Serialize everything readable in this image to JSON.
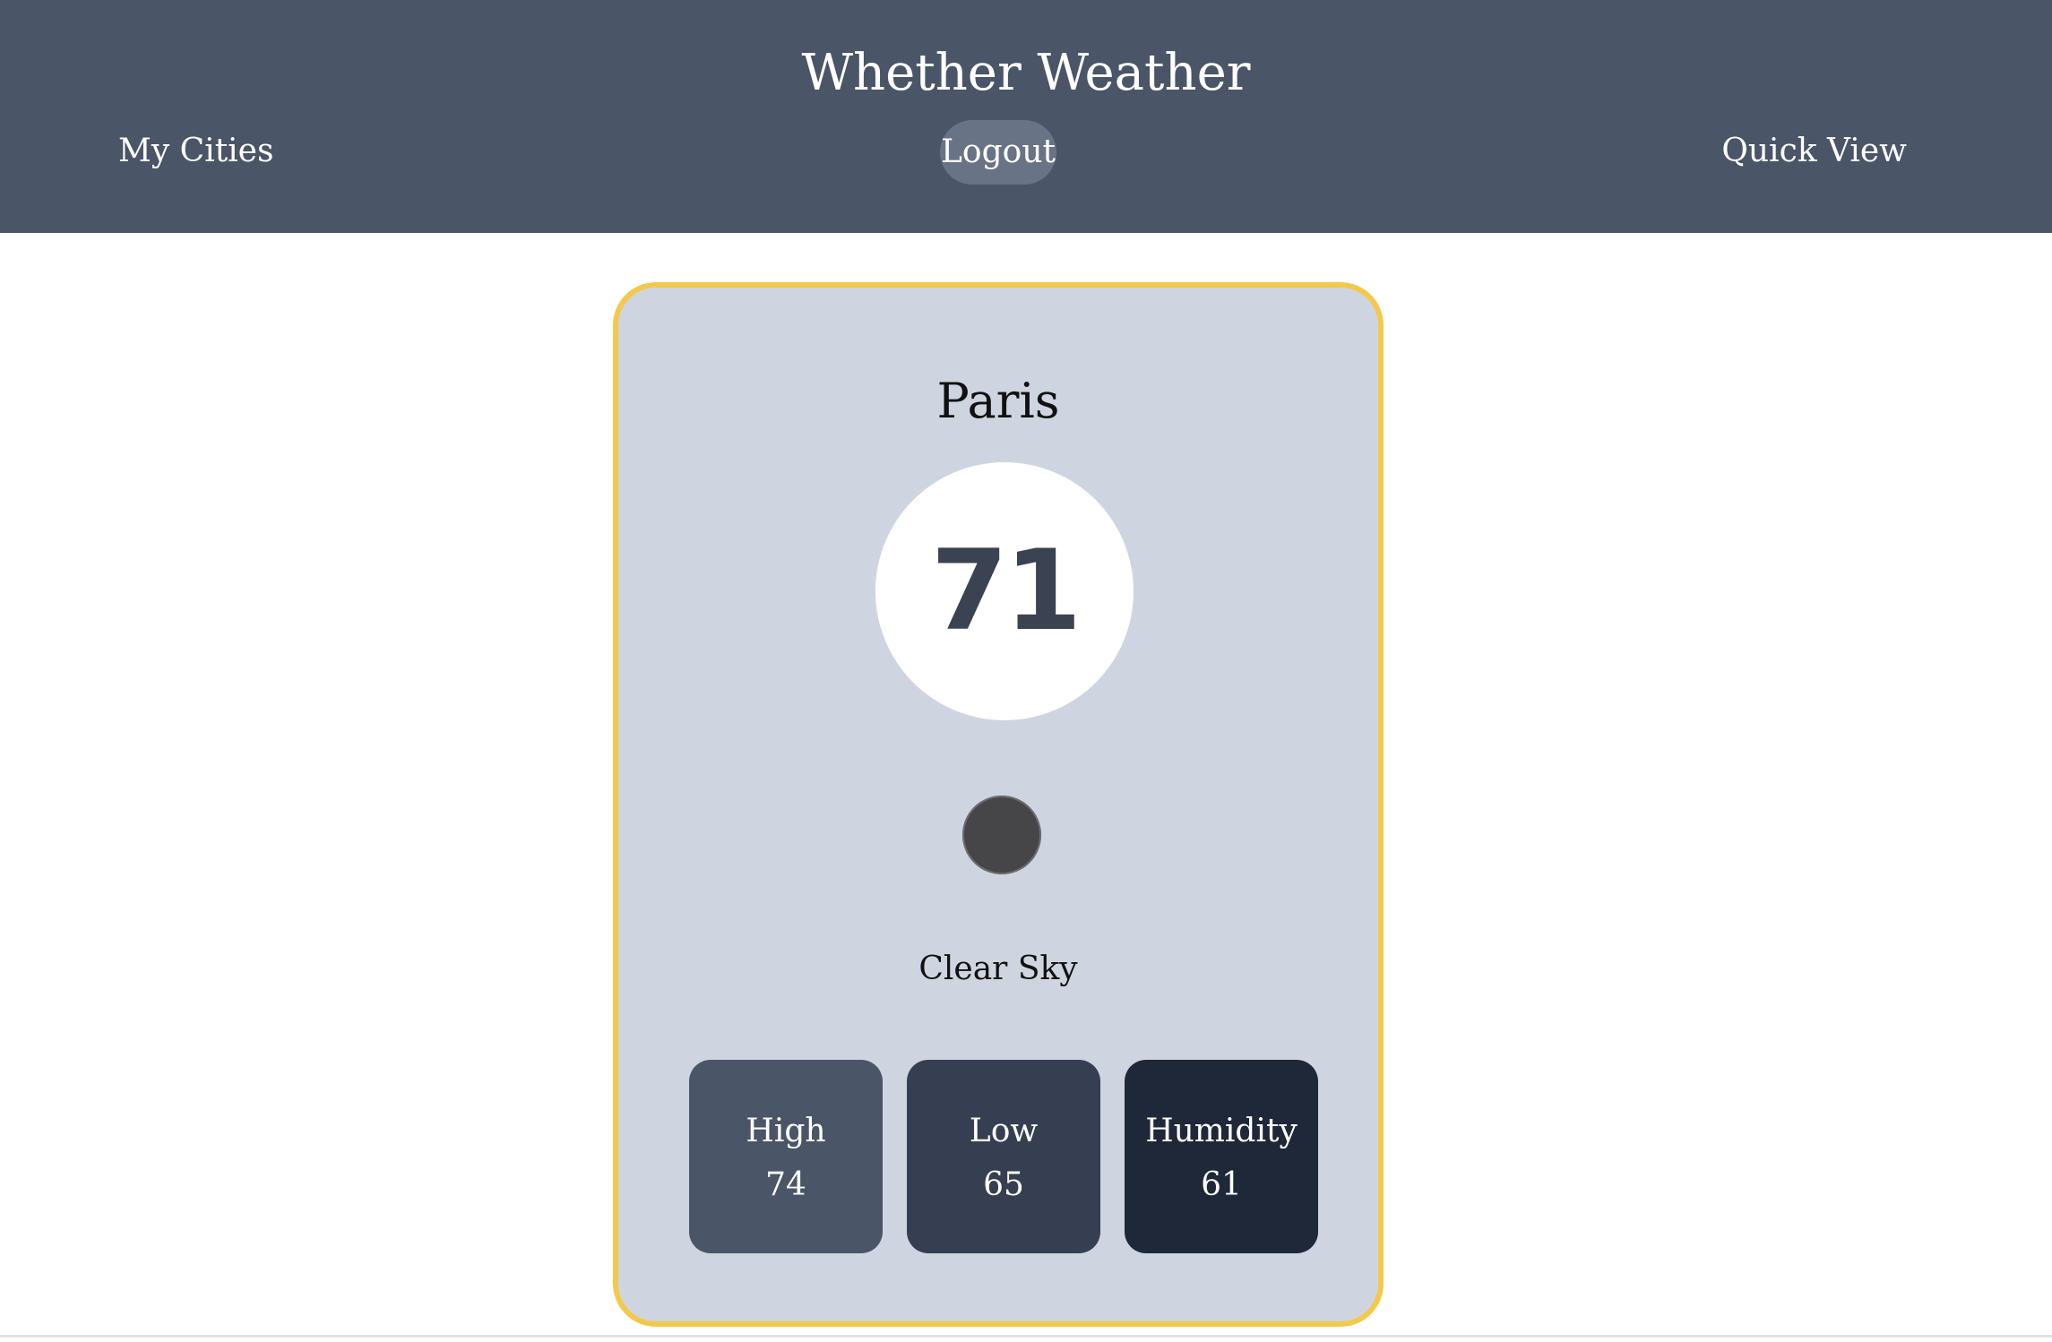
{
  "header": {
    "title": "Whether Weather",
    "nav": {
      "my_cities": "My Cities",
      "logout": "Logout",
      "quick_view": "Quick View"
    },
    "background_color": "#4a5568"
  },
  "weather_card": {
    "city": "Paris",
    "temperature": "71",
    "icon": "weather-condition-icon",
    "condition": "Clear Sky",
    "border_color": "#f2c94c",
    "stats": [
      {
        "label": "High",
        "value": "74"
      },
      {
        "label": "Low",
        "value": "65"
      },
      {
        "label": "Humidity",
        "value": "61"
      }
    ]
  }
}
